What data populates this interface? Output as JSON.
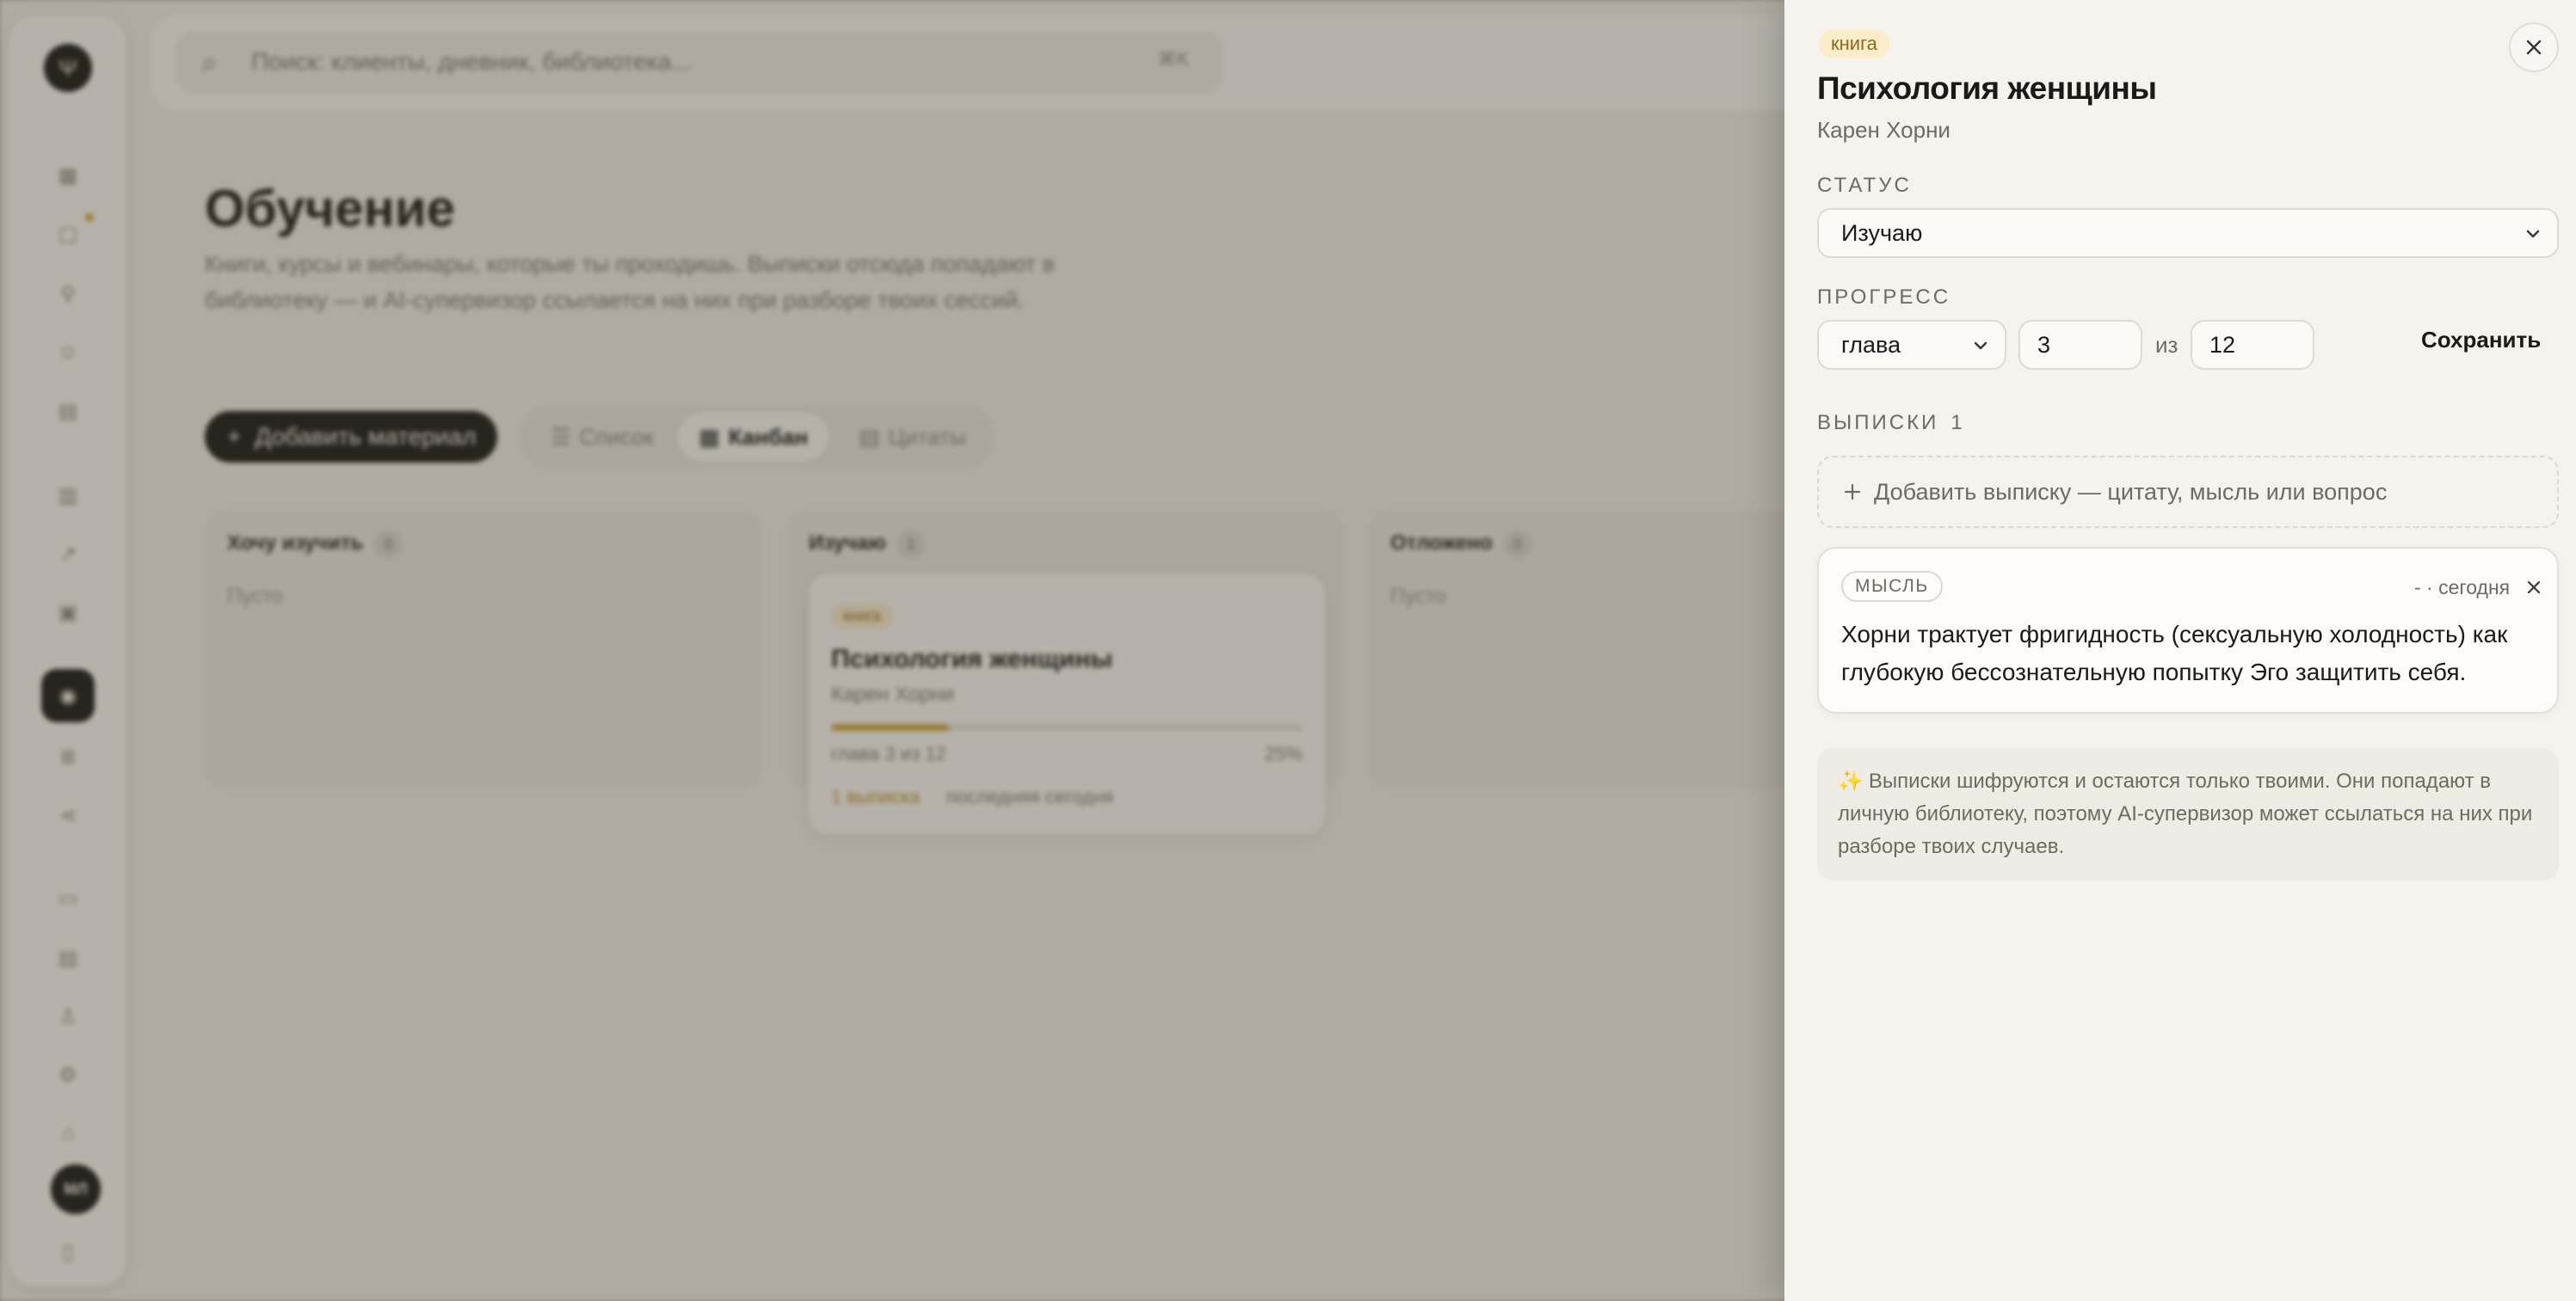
{
  "background": {
    "search": {
      "placeholder": "Поиск: клиенты, дневник, библиотека...",
      "shortcut": "⌘K"
    },
    "page": {
      "title": "Обучение",
      "subtitle": "Книги, курсы и вебинары, которые ты проходишь. Выписки отсюда попадают в библиотеку — и AI-супервизор ссылается на них при разборе твоих сессий."
    },
    "toolbar": {
      "add_label": "Добавить материал",
      "tabs": [
        {
          "label": "Список",
          "active": false
        },
        {
          "label": "Канбан",
          "active": true
        },
        {
          "label": "Цитаты",
          "active": false
        }
      ]
    },
    "kanban": {
      "columns": [
        {
          "title": "Хочу изучить",
          "count": "0",
          "empty": "Пусто"
        },
        {
          "title": "Изучаю",
          "count": "1",
          "empty": ""
        },
        {
          "title": "Отложено",
          "count": "0",
          "empty": "Пусто"
        }
      ],
      "card": {
        "badge": "книга",
        "title": "Психология женщины",
        "author": "Карен Хорни",
        "progress_text": "глава 3 из 12",
        "percent": "25%",
        "progress_fraction": 0.25,
        "excerpts": "1 выписка",
        "last": "последняя сегодня"
      }
    },
    "user": {
      "initials": "МЛ"
    }
  },
  "panel": {
    "badge": "книга",
    "title": "Психология женщины",
    "author": "Карен Хорни",
    "status_label": "СТАТУС",
    "status_value": "Изучаю",
    "progress_label": "ПРОГРЕСС",
    "unit_value": "глава",
    "current": "3",
    "of_label": "из",
    "total": "12",
    "save_label": "Сохранить",
    "notes_label": "ВЫПИСКИ",
    "notes_count": "1",
    "add_note_label": "Добавить выписку — цитату, мысль или вопрос",
    "note": {
      "type": "МЫСЛЬ",
      "meta": "- · сегодня",
      "text": "Хорни трактует фригидность (сексуальную холодность) как глубокую бессознательную попытку Эго защитить себя."
    },
    "info_text": "Выписки шифруются и остаются только твоими. Они попадают в личную библиотеку, поэтому AI-супервизор может ссылаться на них при разборе твоих случаев."
  },
  "colors": {
    "accent": "#c9a13b",
    "badge_bg": "#fbedc9",
    "badge_text": "#8d6a1e",
    "dark": "#1e1b18"
  }
}
